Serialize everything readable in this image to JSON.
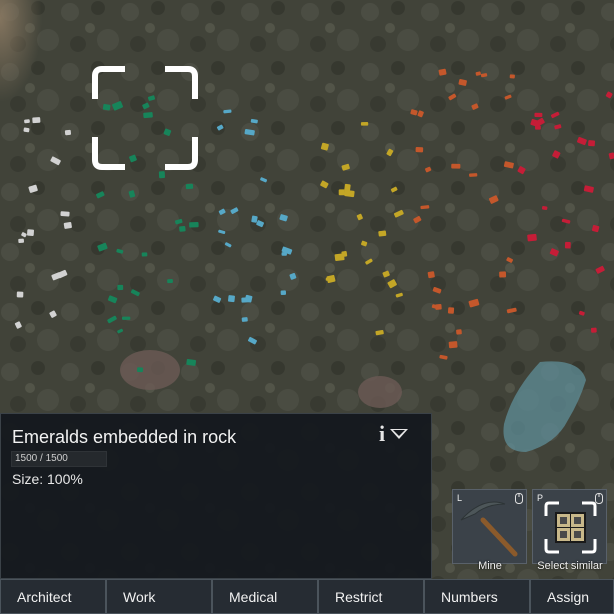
{
  "inspect_panel": {
    "title": "Emeralds embedded in rock",
    "hit_points_text": "1500 / 1500",
    "size_text": "Size: 100%",
    "info_icon": "info-icon",
    "collapse_icon": "caret-down-icon"
  },
  "commands": [
    {
      "hotkey": "L",
      "label": "Mine",
      "icon": "pickaxe-icon"
    },
    {
      "hotkey": "P",
      "label": "Select similar",
      "icon": "select-similar-icon"
    }
  ],
  "tabs": [
    "Architect",
    "Work",
    "Medical",
    "Restrict",
    "Numbers",
    "Assign"
  ],
  "ore_colors": {
    "emerald": "#17845a",
    "sapphire": "#56a8c7",
    "gold": "#c3a626",
    "copper": "#c4572b",
    "ruby": "#c51d37",
    "silver": "#d2d2d2"
  }
}
